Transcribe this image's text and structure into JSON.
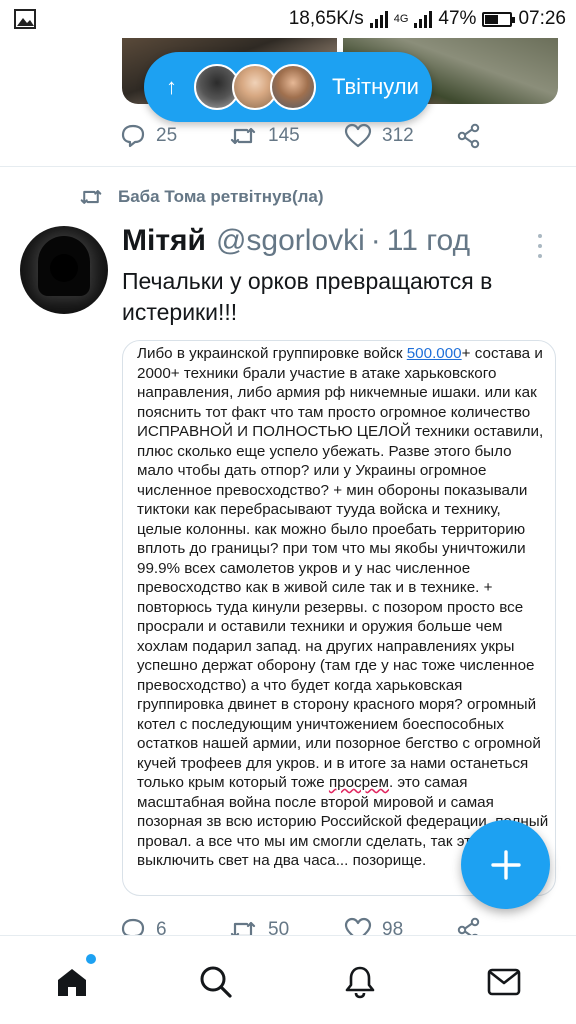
{
  "status_bar": {
    "speed": "18,65K/s",
    "network": "4G",
    "battery": "47%",
    "battery_level": 0.47,
    "time": "07:26"
  },
  "tweeted_pill": {
    "label": "Твітнули",
    "arrow": "↑"
  },
  "prev_tweet": {
    "replies": "25",
    "retweets": "145",
    "likes": "312"
  },
  "retweet_header": "Баба Тома ретвітнув(ла)",
  "tweet": {
    "name": "Мітяй",
    "handle": "@sgorlovki",
    "dot": "·",
    "time": "11 год",
    "text": "Печальки у орков превращаются в истерики!!!",
    "image_text": {
      "before_link": "Либо в украинской группировке войск ",
      "link": "500.000",
      "middle": "+ состава и 2000+ техники брали участие в атаке харьковского направления, либо армия рф никчемные ишаки. или как пояснить тот факт что там просто огромное количество ИСПРАВНОЙ И ПОЛНОСТЬЮ ЦЕЛОЙ техники оставили, плюс сколько еще успело убежать. Разве этого было мало чтобы дать отпор? или у Украины огромное численное превосходство? + мин обороны показывали тиктоки как перебрасывают тууда войска и технику, целые колонны. как можно было проебать территорию вплоть до границы? при том что мы якобы уничтожили 99.9% всех самолетов укров и у нас численное превосходство как в живой силе так и в технике. + повторюсь туда кинули резервы. с позором просто все просрали и оставили техники и оружия больше чем хохлам подарил запад. на других направлениях укры успешно держат оборону (там где у нас тоже численное превосходство) а что будет когда харьковская группировка двинет в сторону красного моря? огромный котел с последующим уничтожением боеспособных остатков нашей армии, или позорное бегство с огромной кучей трофеев для укров. и в итоге за нами останеться только крым который тоже ",
      "misspelled": "просрем",
      "after": ". это самая масштабная война после второй мировой и самая позорная зв всю историю Российской федерации. полный провал. а все что мы им смогли сделать, так это выключить свет на два часа... позорище."
    },
    "replies": "6",
    "retweets": "50",
    "likes": "98"
  },
  "icons": {
    "status_image": "image-icon",
    "signal": "signal-icon",
    "battery": "battery-icon",
    "reply": "reply-icon",
    "retweet": "retweet-icon",
    "like": "heart-icon",
    "share": "share-icon",
    "compose": "plus-icon",
    "home": "home-icon",
    "search": "search-icon",
    "notifications": "bell-icon",
    "messages": "mail-icon"
  },
  "colors": {
    "accent": "#1da1f2",
    "secondary_text": "#657786",
    "link": "#1e6fd9"
  }
}
